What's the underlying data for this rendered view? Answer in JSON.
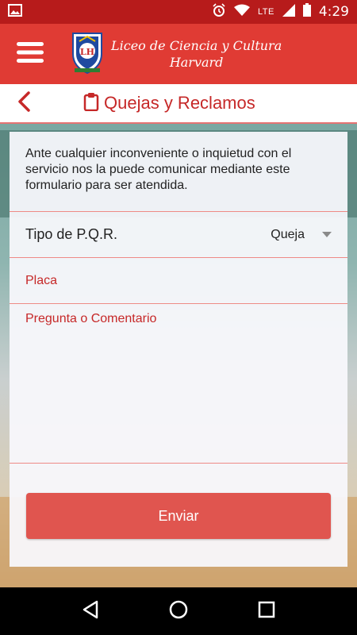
{
  "status_bar": {
    "time": "4:29",
    "network": "LTE",
    "icons": [
      "image-icon",
      "alarm-icon",
      "wifi-icon",
      "signal-icon",
      "battery-icon"
    ]
  },
  "app_bar": {
    "brand_line1": "Liceo de Ciencia y Cultura",
    "brand_line2": "Harvard",
    "logo_text": "LH",
    "icons": [
      "menu-icon",
      "school-crest-logo"
    ],
    "color": "#e03b34"
  },
  "sub_header": {
    "title": "Quejas y Reclamos",
    "icons": [
      "back-icon",
      "clipboard-icon"
    ],
    "color": "#c62828"
  },
  "form": {
    "intro": "Ante cualquier inconveniente o inquietud con el servicio nos la puede comunicar mediante este formulario para ser atendida.",
    "type_label": "Tipo de P.Q.R.",
    "type_value": "Queja",
    "plate_placeholder": "Placa",
    "comment_placeholder": "Pregunta o Comentario",
    "submit_label": "Enviar",
    "submit_color": "#e0554f"
  },
  "nav_bar": {
    "icons": [
      "back-triangle-icon",
      "home-circle-icon",
      "recents-square-icon"
    ]
  }
}
